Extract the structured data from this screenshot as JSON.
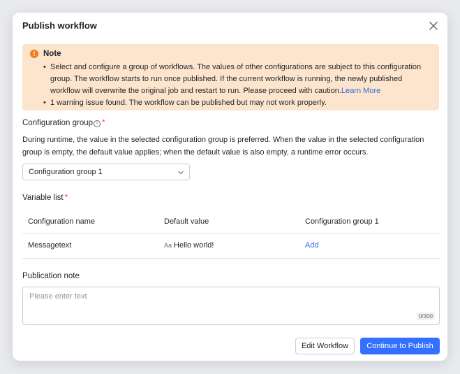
{
  "dialog": {
    "title": "Publish workflow",
    "close_icon": "close-icon"
  },
  "note": {
    "icon": "warning-icon",
    "title": "Note",
    "item1_text": "Select and configure a group of workflows. The values of other configurations are subject to this configuration group. The workflow starts to run once published. If the current workflow is running, the newly published workflow will overwrite the original job and restart to run. Please proceed with caution.",
    "item1_link": "Learn More",
    "item2_text": "1 warning issue found. The workflow can be published but may not work properly."
  },
  "config_group": {
    "label": "Configuration group",
    "required": "*",
    "info_icon": "i",
    "description": "During runtime, the value in the selected configuration group is preferred. When the value in the selected configuration group is empty, the default value applies; when the default value is also empty, a runtime error occurs.",
    "selected": "Configuration group 1"
  },
  "variables": {
    "label": "Variable list",
    "required": "*",
    "columns": [
      "Configuration name",
      "Default value",
      "Configuration group 1"
    ],
    "rows": [
      {
        "name": "Messagetext",
        "type_glyph": "Aa",
        "default_value": "Hello world!",
        "action": "Add"
      }
    ]
  },
  "publication_note": {
    "label": "Publication note",
    "placeholder": "Please enter text",
    "counter": "0/300"
  },
  "footer": {
    "edit_label": "Edit Workflow",
    "continue_label": "Continue to Publish"
  },
  "colors": {
    "primary": "#3370ff",
    "note_bg": "#fde5cd",
    "warning": "#ef7d22",
    "required": "#f54a45",
    "link": "#2d6be4"
  }
}
